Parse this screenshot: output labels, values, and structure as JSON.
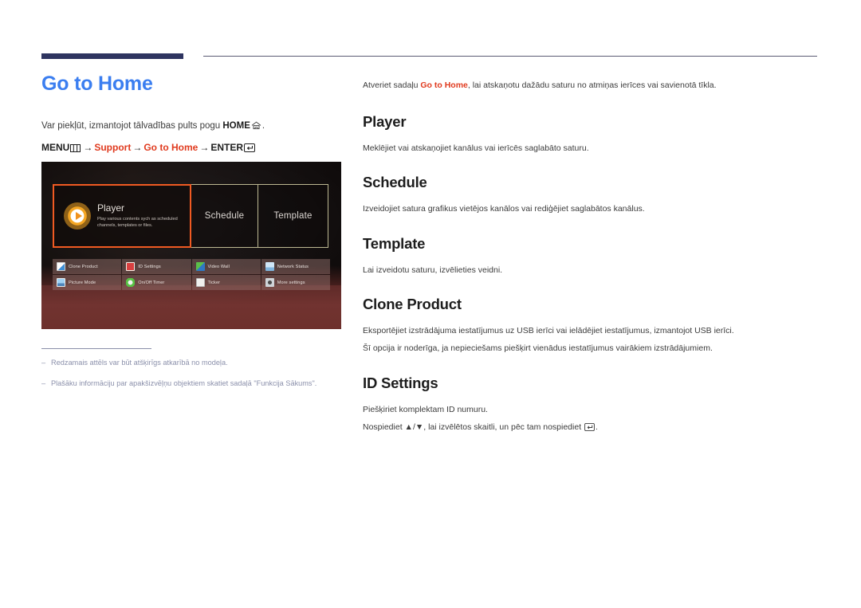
{
  "colors": {
    "accent_blue": "#3b7ef0",
    "accent_red": "#e03a1e",
    "rule_navy": "#2e3460",
    "note_text": "#8b90ab",
    "highlight_border": "#f05a22"
  },
  "left": {
    "page_title": "Go to Home",
    "access_prefix": "Var piekļūt, izmantojot tālvadības pults pogu ",
    "access_bold": "HOME",
    "access_suffix": ".",
    "menu_path": {
      "menu_label": "MENU",
      "arrow": "→",
      "support": "Support",
      "go_to_home": "Go to Home",
      "enter_label": "ENTER"
    },
    "notes": [
      "Redzamais attēls var būt atšķirīgs atkarībā no modeļa.",
      "Plašāku informāciju par apakšizvēļņu objektiem skatiet sadaļā \"Funkcija Sākums\"."
    ],
    "dash": "–"
  },
  "tv_screen": {
    "main_tiles": [
      {
        "name": "Player",
        "description": "Play various contents sych as scheduled channels, templates or files.",
        "selected": true,
        "icon": "play-circle-icon"
      },
      {
        "name": "Schedule",
        "description": "",
        "selected": false,
        "icon": ""
      },
      {
        "name": "Template",
        "description": "",
        "selected": false,
        "icon": ""
      }
    ],
    "small_tiles": [
      {
        "label": "Clone Product",
        "icon": "clone-product-icon"
      },
      {
        "label": "ID Settings",
        "icon": "id-settings-icon"
      },
      {
        "label": "Video Wall",
        "icon": "video-wall-icon"
      },
      {
        "label": "Network Status",
        "icon": "network-status-icon"
      },
      {
        "label": "Picture Mode",
        "icon": "picture-mode-icon"
      },
      {
        "label": "On/Off Timer",
        "icon": "on-off-timer-icon"
      },
      {
        "label": "Ticker",
        "icon": "ticker-icon"
      },
      {
        "label": "More settings",
        "icon": "more-settings-icon"
      }
    ]
  },
  "right": {
    "intro": {
      "prefix": "Atveriet sadaļu ",
      "highlight": "Go to Home",
      "suffix": ", lai atskaņotu dažādu saturu no atmiņas ierīces vai savienotā tīkla."
    },
    "sections": [
      {
        "heading": "Player",
        "paragraphs": [
          "Meklējiet vai atskaņojiet kanālus vai ierīcēs saglabāto saturu."
        ]
      },
      {
        "heading": "Schedule",
        "paragraphs": [
          "Izveidojiet satura grafikus vietējos kanālos vai rediģējiet saglabātos kanālus."
        ]
      },
      {
        "heading": "Template",
        "paragraphs": [
          "Lai izveidotu saturu, izvēlieties veidni."
        ]
      },
      {
        "heading": "Clone Product",
        "paragraphs": [
          "Eksportējiet izstrādājuma iestatījumus uz USB ierīci vai ielādējiet iestatījumus, izmantojot USB ierīci.",
          "Šī opcija ir noderīga, ja nepieciešams piešķirt vienādus iestatījumus vairākiem izstrādājumiem."
        ]
      },
      {
        "heading": "ID Settings",
        "paragraphs": [
          "Piešķiriet komplektam ID numuru."
        ],
        "nav_line": {
          "prefix": "Nospiediet ",
          "up": "▲",
          "slash": "/",
          "down": "▼",
          "middle": ", lai izvēlētos skaitli, un pēc tam nospiediet ",
          "suffix": "."
        }
      }
    ]
  }
}
